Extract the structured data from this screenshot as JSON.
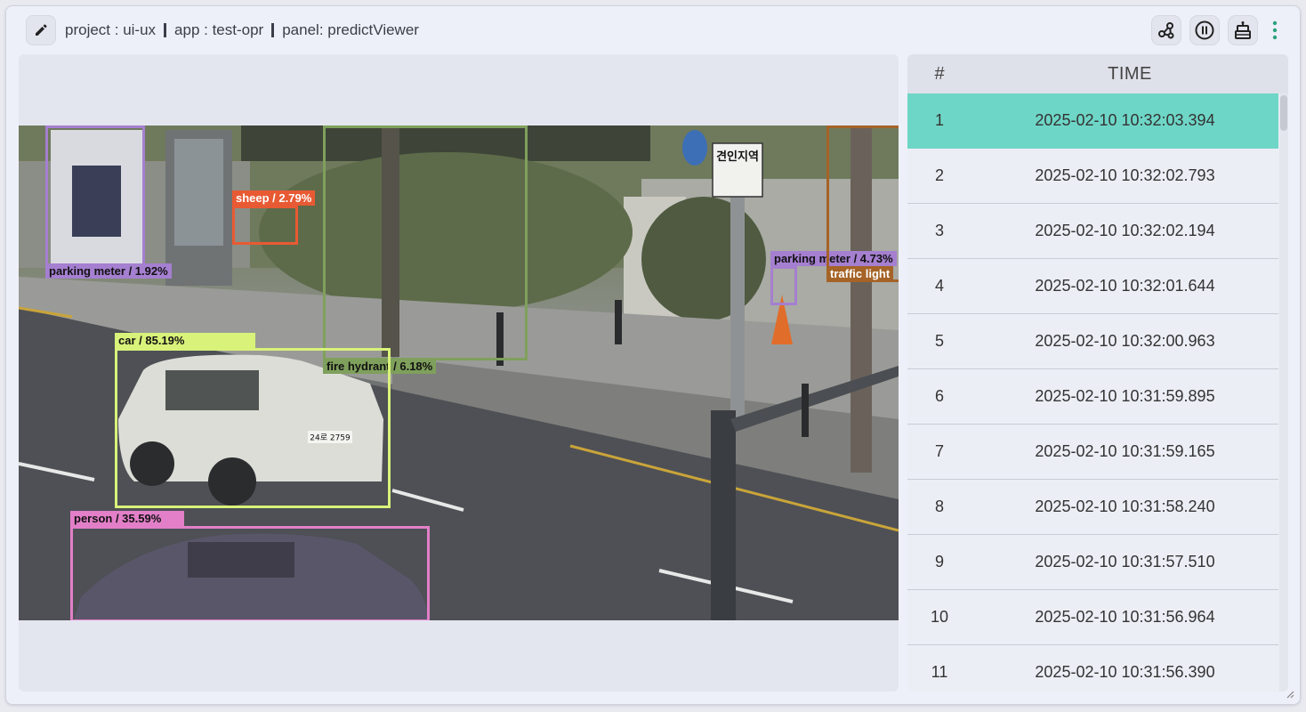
{
  "header": {
    "breadcrumb": [
      "project : ui-ux",
      "app : test-opr",
      "panel: predictViewer"
    ],
    "icons": [
      "pencil-icon",
      "graph-nodes-icon",
      "pause-icon",
      "robot-icon",
      "more-vertical-icon"
    ]
  },
  "detections": [
    {
      "label": "parking meter / 1.92%",
      "color": "#a57fd0"
    },
    {
      "label": "sheep / 2.79%",
      "color": "#e85a33"
    },
    {
      "label": "fire hydrant / 6.18%",
      "color": "#7fa05c"
    },
    {
      "label": "parking meter / 4.73%",
      "color": "#a57fd0"
    },
    {
      "label": "traffic light",
      "color": "#a56327"
    },
    {
      "label": "car / 85.19%",
      "color": "#d9f27a"
    },
    {
      "label": "person / 35.59%",
      "color": "#e27fc8"
    }
  ],
  "signs": {
    "road_sign": "견인지역",
    "plate": "24로 2759"
  },
  "table": {
    "headers": [
      "#",
      "TIME"
    ],
    "rows": [
      {
        "n": "1",
        "time": "2025-02-10 10:32:03.394"
      },
      {
        "n": "2",
        "time": "2025-02-10 10:32:02.793"
      },
      {
        "n": "3",
        "time": "2025-02-10 10:32:02.194"
      },
      {
        "n": "4",
        "time": "2025-02-10 10:32:01.644"
      },
      {
        "n": "5",
        "time": "2025-02-10 10:32:00.963"
      },
      {
        "n": "6",
        "time": "2025-02-10 10:31:59.895"
      },
      {
        "n": "7",
        "time": "2025-02-10 10:31:59.165"
      },
      {
        "n": "8",
        "time": "2025-02-10 10:31:58.240"
      },
      {
        "n": "9",
        "time": "2025-02-10 10:31:57.510"
      },
      {
        "n": "10",
        "time": "2025-02-10 10:31:56.964"
      },
      {
        "n": "11",
        "time": "2025-02-10 10:31:56.390"
      }
    ],
    "selected_row": "1",
    "selected_color": "#6ed6c7"
  }
}
